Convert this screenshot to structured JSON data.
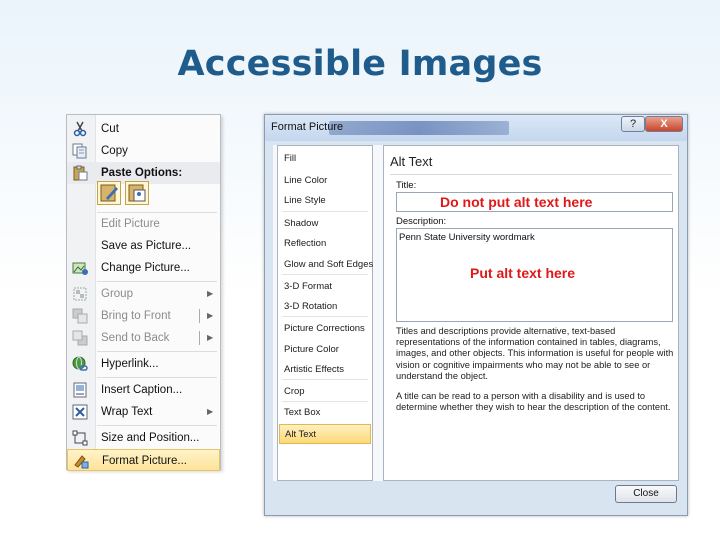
{
  "slide": {
    "title": "Accessible Images"
  },
  "context_menu": {
    "items": [
      {
        "label": "Cut",
        "icon": "scissors-icon"
      },
      {
        "label": "Copy",
        "icon": "copy-icon"
      },
      {
        "label": "Paste Options:",
        "icon": "clipboard-icon"
      },
      {
        "label": "Edit Picture"
      },
      {
        "label": "Save as Picture..."
      },
      {
        "label": "Change Picture...",
        "icon": "change-picture-icon"
      },
      {
        "label": "Group",
        "icon": "group-icon"
      },
      {
        "label": "Bring to Front",
        "icon": "bring-front-icon"
      },
      {
        "label": "Send to Back",
        "icon": "send-back-icon"
      },
      {
        "label": "Hyperlink...",
        "icon": "globe-link-icon"
      },
      {
        "label": "Insert Caption...",
        "icon": "caption-icon"
      },
      {
        "label": "Wrap Text",
        "icon": "wrap-text-icon"
      },
      {
        "label": "Size and Position...",
        "icon": "size-position-icon"
      },
      {
        "label": "Format Picture...",
        "icon": "format-picture-icon"
      }
    ]
  },
  "dialog": {
    "title": "Format Picture",
    "help_label": "?",
    "close_label": "X",
    "nav": [
      "Fill",
      "Line Color",
      "Line Style",
      "Shadow",
      "Reflection",
      "Glow and Soft Edges",
      "3-D Format",
      "3-D Rotation",
      "Picture Corrections",
      "Picture Color",
      "Artistic Effects",
      "Crop",
      "Text Box",
      "Alt Text"
    ],
    "pane": {
      "heading": "Alt Text",
      "title_label": "Title:",
      "title_annotation": "Do not put alt text here",
      "description_label": "Description:",
      "description_value": "Penn State University wordmark",
      "description_annotation": "Put alt text here",
      "help_1": "Titles and descriptions provide alternative, text-based representations of the information contained in tables, diagrams, images, and other objects. This information is useful for people with vision or cognitive impairments who may not be able to see or understand the object.",
      "help_2": "A title can be read to a person with a disability and is used to determine whether they wish to hear the description of the content."
    },
    "close_button": "Close"
  },
  "colors": {
    "title": "#1f5c8b",
    "annotation": "#e01818",
    "highlight": "#fde39a"
  }
}
